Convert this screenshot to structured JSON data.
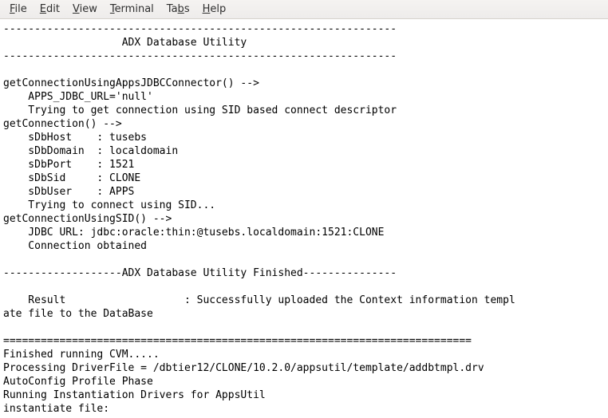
{
  "menubar": {
    "file": {
      "accel": "F",
      "rest": "ile"
    },
    "edit": {
      "accel": "E",
      "rest": "dit"
    },
    "view": {
      "accel": "V",
      "rest": "iew"
    },
    "terminal": {
      "accel": "T",
      "rest": "erminal"
    },
    "tabs": {
      "pre": "Ta",
      "accel": "b",
      "rest": "s"
    },
    "help": {
      "accel": "H",
      "rest": "elp"
    }
  },
  "terminal": {
    "lines": [
      "---------------------------------------------------------------",
      "                   ADX Database Utility                         ",
      "---------------------------------------------------------------",
      "",
      "getConnectionUsingAppsJDBCConnector() -->",
      "    APPS_JDBC_URL='null'",
      "    Trying to get connection using SID based connect descriptor",
      "getConnection() -->",
      "    sDbHost    : tusebs",
      "    sDbDomain  : localdomain",
      "    sDbPort    : 1521",
      "    sDbSid     : CLONE",
      "    sDbUser    : APPS",
      "    Trying to connect using SID...",
      "getConnectionUsingSID() -->",
      "    JDBC URL: jdbc:oracle:thin:@tusebs.localdomain:1521:CLONE",
      "    Connection obtained",
      "",
      "-------------------ADX Database Utility Finished---------------",
      "",
      "    Result                   : Successfully uploaded the Context information templ",
      "ate file to the DataBase",
      "",
      "===========================================================================",
      "Finished running CVM.....",
      "Processing DriverFile = /dbtier12/CLONE/10.2.0/appsutil/template/addbtmpl.drv",
      "AutoConfig Profile Phase",
      "Running Instantiation Drivers for AppsUtil",
      "instantiate file:"
    ]
  }
}
